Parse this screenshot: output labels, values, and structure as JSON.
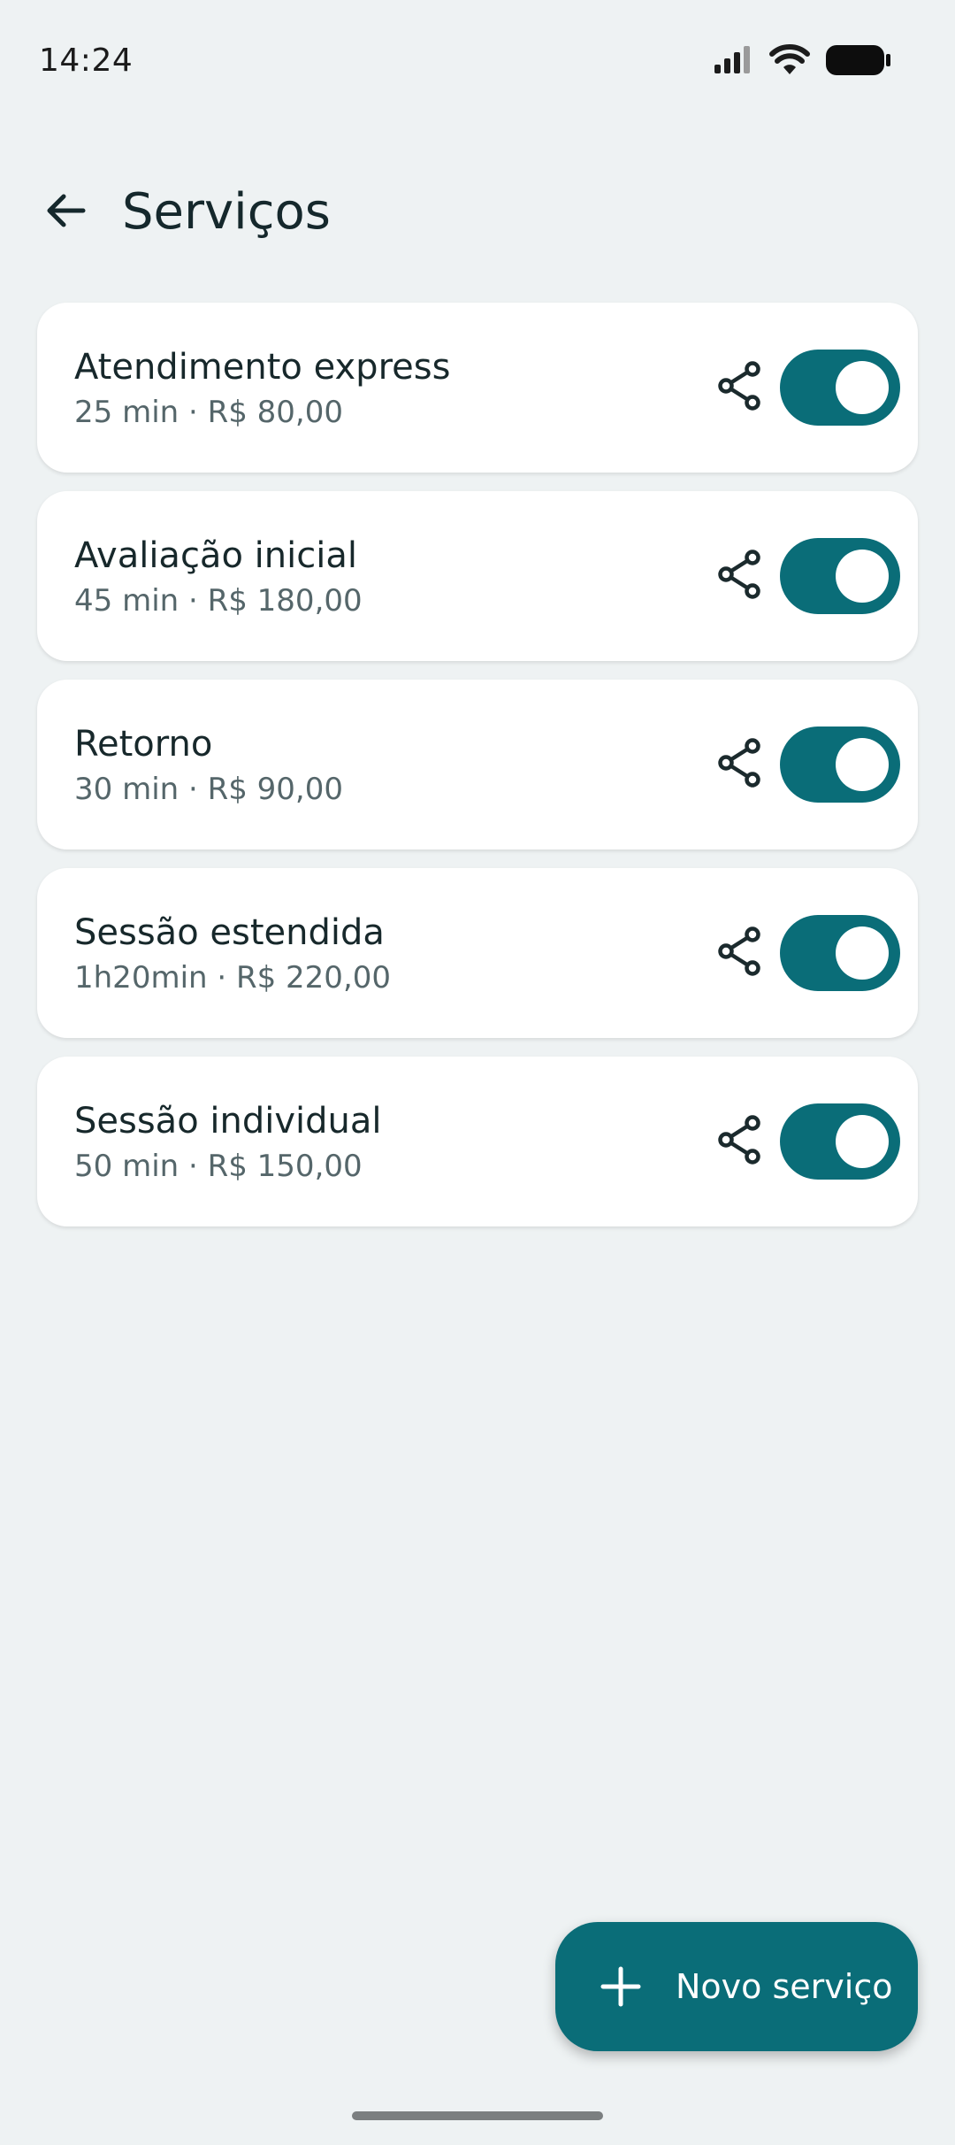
{
  "status_bar": {
    "time": "14:24",
    "icons": [
      "signal-icon",
      "wifi-icon",
      "battery-icon"
    ]
  },
  "header": {
    "back_icon": "arrow-back-icon",
    "title": "Serviços"
  },
  "services": [
    {
      "name": "Atendimento express",
      "details": "25 min · R$ 80,00",
      "enabled": true
    },
    {
      "name": "Avaliação inicial",
      "details": "45 min · R$ 180,00",
      "enabled": true
    },
    {
      "name": "Retorno",
      "details": "30 min · R$ 90,00",
      "enabled": true
    },
    {
      "name": "Sessão estendida",
      "details": "1h20min · R$ 220,00",
      "enabled": true
    },
    {
      "name": "Sessão individual",
      "details": "50 min · R$ 150,00",
      "enabled": true
    }
  ],
  "fab": {
    "icon": "plus-icon",
    "label": "Novo serviço"
  },
  "colors": {
    "accent": "#0a6d78",
    "background": "#eef2f3",
    "card": "#ffffff"
  }
}
